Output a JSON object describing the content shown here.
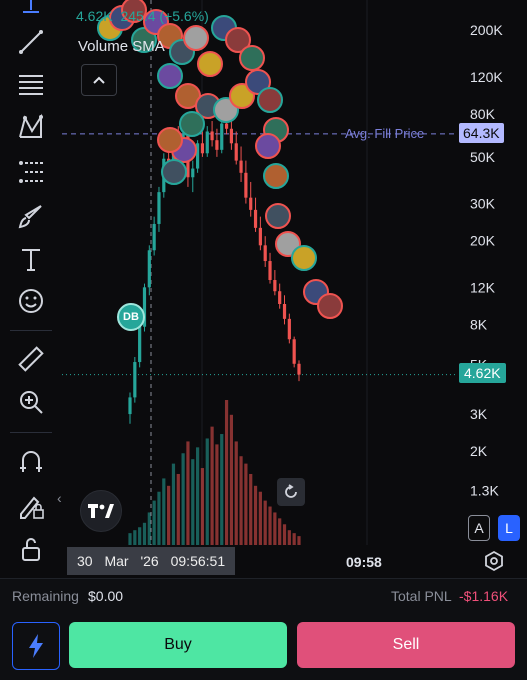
{
  "legend": {
    "price_value": "4.62K",
    "volume_partial": "245.4",
    "change_partial": "(+5.6%)",
    "indicator_label": "Volume SMA"
  },
  "price_axis": {
    "ticks": [
      "200K",
      "120K",
      "80K",
      "50K",
      "30K",
      "20K",
      "12K",
      "8K",
      "3K",
      "2K",
      "1.3K"
    ],
    "avg_fill_label": "Avg. Fill Price",
    "avg_fill_value": "64.3K",
    "current_price_label": "4.62K",
    "hidden_tick_partial": "5K"
  },
  "time_axis": {
    "crosshair_date": "30 Mar '26",
    "crosshair_time": "09:56:51",
    "tick_label": "09:58"
  },
  "markers": {
    "db_badge": "DB"
  },
  "scale_toggles": {
    "auto": "A",
    "log": "L"
  },
  "footer": {
    "remaining_label": "Remaining",
    "remaining_value": "$0.00",
    "pnl_label": "Total PNL",
    "pnl_value": "-$1.16K"
  },
  "actions": {
    "buy": "Buy",
    "sell": "Sell"
  },
  "colors": {
    "up": "#26a69a",
    "down": "#ef5350",
    "avg_line": "#7b7fd9",
    "avg_tag": "#b3b9ff",
    "current_tag": "#26a69a",
    "buy": "#4ee6a3",
    "sell": "#e0507a",
    "pnl_negative": "#f0507a"
  },
  "chart_data": {
    "type": "candlestick",
    "scale": "log",
    "ylim": [
      1000,
      240000
    ],
    "avg_fill_price": 64300,
    "current_price": 4620,
    "candles": [
      {
        "o": 3000,
        "h": 3800,
        "l": 2700,
        "c": 3600
      },
      {
        "o": 3600,
        "h": 5600,
        "l": 3400,
        "c": 5300
      },
      {
        "o": 5300,
        "h": 8200,
        "l": 5000,
        "c": 7800
      },
      {
        "o": 7800,
        "h": 12500,
        "l": 7400,
        "c": 12000
      },
      {
        "o": 12000,
        "h": 19000,
        "l": 11000,
        "c": 18000
      },
      {
        "o": 18000,
        "h": 26000,
        "l": 17000,
        "c": 24000
      },
      {
        "o": 24000,
        "h": 36000,
        "l": 22000,
        "c": 34000
      },
      {
        "o": 34000,
        "h": 52000,
        "l": 32000,
        "c": 49000
      },
      {
        "o": 49000,
        "h": 62000,
        "l": 42000,
        "c": 45000
      },
      {
        "o": 45000,
        "h": 66000,
        "l": 43000,
        "c": 62000
      },
      {
        "o": 62000,
        "h": 70000,
        "l": 52000,
        "c": 55000
      },
      {
        "o": 55000,
        "h": 68000,
        "l": 50000,
        "c": 64000
      },
      {
        "o": 64000,
        "h": 72000,
        "l": 36000,
        "c": 40000
      },
      {
        "o": 40000,
        "h": 48000,
        "l": 34000,
        "c": 44000
      },
      {
        "o": 44000,
        "h": 60000,
        "l": 42000,
        "c": 58000
      },
      {
        "o": 58000,
        "h": 66000,
        "l": 50000,
        "c": 52000
      },
      {
        "o": 52000,
        "h": 70000,
        "l": 50000,
        "c": 66000
      },
      {
        "o": 66000,
        "h": 74000,
        "l": 56000,
        "c": 60000
      },
      {
        "o": 60000,
        "h": 68000,
        "l": 50000,
        "c": 54000
      },
      {
        "o": 54000,
        "h": 80000,
        "l": 52000,
        "c": 72000
      },
      {
        "o": 72000,
        "h": 82000,
        "l": 64000,
        "c": 68000
      },
      {
        "o": 68000,
        "h": 76000,
        "l": 54000,
        "c": 58000
      },
      {
        "o": 58000,
        "h": 66000,
        "l": 46000,
        "c": 48000
      },
      {
        "o": 48000,
        "h": 56000,
        "l": 38000,
        "c": 42000
      },
      {
        "o": 42000,
        "h": 48000,
        "l": 30000,
        "c": 32000
      },
      {
        "o": 32000,
        "h": 38000,
        "l": 26000,
        "c": 28000
      },
      {
        "o": 28000,
        "h": 32000,
        "l": 22000,
        "c": 23000
      },
      {
        "o": 23000,
        "h": 26000,
        "l": 18000,
        "c": 19000
      },
      {
        "o": 19000,
        "h": 21000,
        "l": 15000,
        "c": 16000
      },
      {
        "o": 16000,
        "h": 17500,
        "l": 12500,
        "c": 13000
      },
      {
        "o": 13000,
        "h": 14500,
        "l": 11000,
        "c": 11500
      },
      {
        "o": 11500,
        "h": 12500,
        "l": 9500,
        "c": 10000
      },
      {
        "o": 10000,
        "h": 11000,
        "l": 8000,
        "c": 8500
      },
      {
        "o": 8500,
        "h": 9000,
        "l": 6500,
        "c": 6800
      },
      {
        "o": 6800,
        "h": 7000,
        "l": 5000,
        "c": 5200
      },
      {
        "o": 5200,
        "h": 5400,
        "l": 4300,
        "c": 4620
      }
    ],
    "volume": [
      8,
      10,
      12,
      15,
      22,
      30,
      36,
      45,
      40,
      55,
      48,
      62,
      70,
      58,
      66,
      52,
      72,
      80,
      68,
      75,
      98,
      88,
      70,
      60,
      55,
      48,
      40,
      36,
      30,
      26,
      22,
      18,
      14,
      10,
      8,
      6
    ]
  }
}
